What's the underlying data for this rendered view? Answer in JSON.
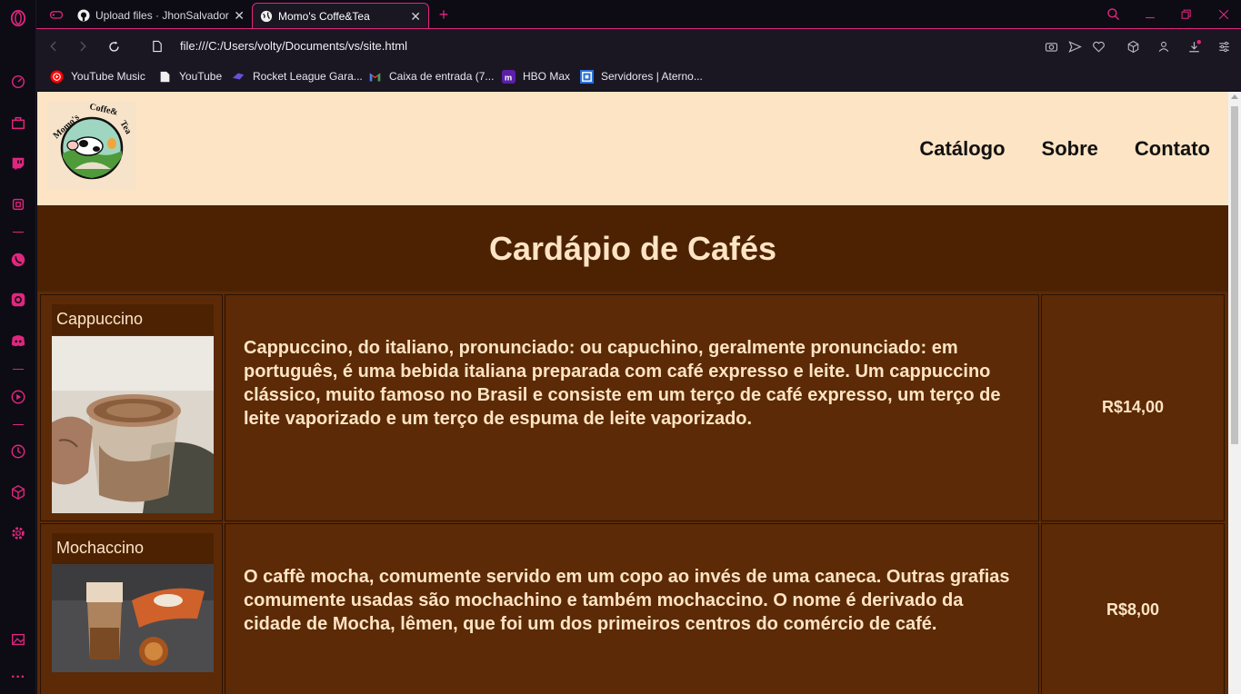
{
  "browser": {
    "tabs": [
      {
        "title": "Upload files · JhonSalvador",
        "close": "✕"
      },
      {
        "title": "Momo's Coffe&Tea",
        "close": "✕"
      }
    ],
    "new_tab": "+",
    "url": "file:///C:/Users/volty/Documents/vs/site.html",
    "bookmarks": [
      {
        "label": "YouTube Music",
        "icon": "youtube-music-icon"
      },
      {
        "label": "YouTube",
        "icon": "page-icon"
      },
      {
        "label": "Rocket League Gara...",
        "icon": "rocket-league-icon"
      },
      {
        "label": "Caixa de entrada (7...",
        "icon": "gmail-icon"
      },
      {
        "label": "HBO Max",
        "icon": "hbo-max-icon"
      },
      {
        "label": "Servidores | Aterno...",
        "icon": "aternos-icon"
      }
    ],
    "accent": "#e0267e"
  },
  "site": {
    "logo_text": "Momo's Coffe&Tea",
    "nav": [
      "Catálogo",
      "Sobre",
      "Contato"
    ],
    "title": "Cardápio de Cafés",
    "items": [
      {
        "name": "Cappuccino",
        "description": "Cappuccino, do italiano, pronunciado: ou capuchino, geralmente pronunciado: em português, é uma bebida italiana preparada com café expresso e leite. Um cappuccino clássico, muito famoso no Brasil e consiste em um terço de café expresso, um terço de leite vaporizado e um terço de espuma de leite vaporizado.",
        "price": "R$14,00"
      },
      {
        "name": "Mochaccino",
        "description": "O caffè mocha, comumente servido em um copo ao invés de uma caneca. Outras grafias comumente usadas são mochachino e também mochaccino. O nome é derivado da cidade de Mocha, lêmen, que foi um dos primeiros centros do comércio de café.",
        "price": "R$8,00"
      }
    ],
    "colors": {
      "header_bg": "#fde4c4",
      "hero_bg": "#4c2203",
      "table_bg": "#5c2a06",
      "text": "#fde4c4"
    }
  }
}
